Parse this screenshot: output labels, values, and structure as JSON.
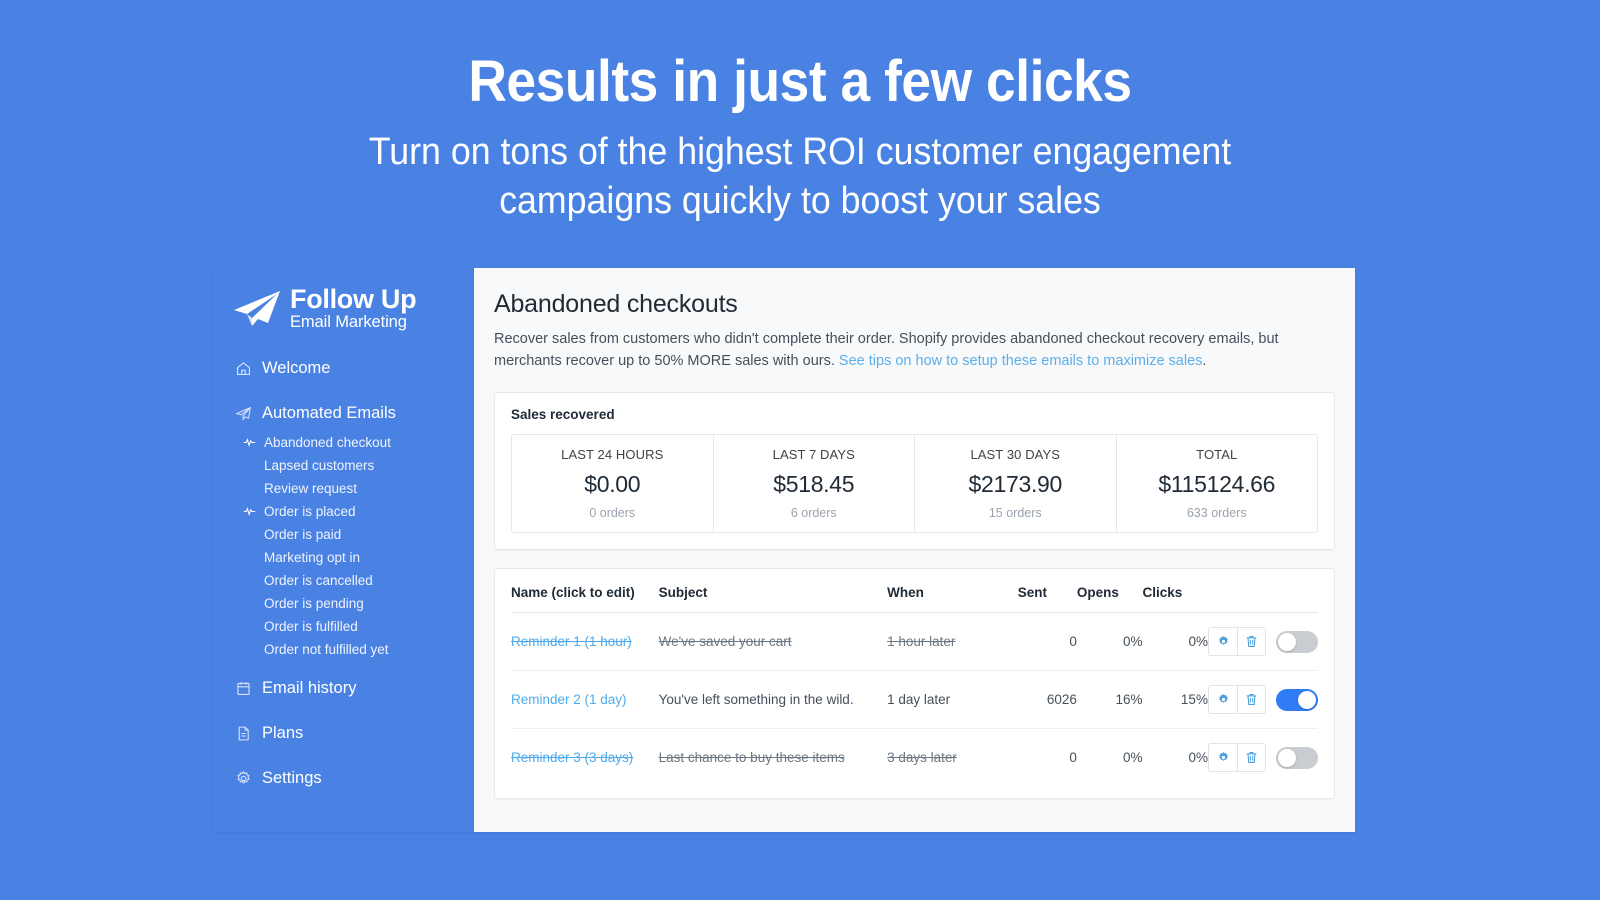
{
  "hero": {
    "title": "Results in just a few clicks",
    "subtitle_line1": "Turn on tons of the highest ROI customer engagement",
    "subtitle_line2": "campaigns quickly to boost your sales",
    "background_color": "#4a82e4"
  },
  "sidebar": {
    "background_color": "#4a82e4",
    "logo": {
      "icon": "paper-plane-icon",
      "title": "Follow Up",
      "subtitle": "Email Marketing"
    },
    "items": [
      {
        "label": "Welcome",
        "icon": "home-icon"
      },
      {
        "label": "Automated Emails",
        "icon": "paper-plane-icon"
      },
      {
        "label": "Email history",
        "icon": "calendar-icon"
      },
      {
        "label": "Plans",
        "icon": "document-icon"
      },
      {
        "label": "Settings",
        "icon": "gear-icon"
      }
    ],
    "sub_items": [
      {
        "label": "Abandoned checkout",
        "icon": "pulse-icon",
        "active": true
      },
      {
        "label": "Lapsed customers",
        "icon": "",
        "active": false
      },
      {
        "label": "Review request",
        "icon": "",
        "active": false
      },
      {
        "label": "Order is placed",
        "icon": "pulse-icon",
        "active": true
      },
      {
        "label": "Order is paid",
        "icon": "",
        "active": false
      },
      {
        "label": "Marketing opt in",
        "icon": "",
        "active": false
      },
      {
        "label": "Order is cancelled",
        "icon": "",
        "active": false
      },
      {
        "label": "Order is pending",
        "icon": "",
        "active": false
      },
      {
        "label": "Order is fulfilled",
        "icon": "",
        "active": false
      },
      {
        "label": "Order not fulfilled yet",
        "icon": "",
        "active": false
      }
    ]
  },
  "main": {
    "page_title": "Abandoned checkouts",
    "description_part1": "Recover sales from customers who didn't complete their order. Shopify provides abandoned checkout recovery emails, but merchants recover up to 50% MORE sales with ours. ",
    "description_link": "See tips on how to setup these emails to maximize sales",
    "description_part2": ".",
    "link_color": "#5cafe9",
    "stats": {
      "title": "Sales recovered",
      "cells": [
        {
          "label": "LAST 24 HOURS",
          "value": "$0.00",
          "orders": "0 orders"
        },
        {
          "label": "LAST 7 DAYS",
          "value": "$518.45",
          "orders": "6 orders"
        },
        {
          "label": "LAST 30 DAYS",
          "value": "$2173.90",
          "orders": "15 orders"
        },
        {
          "label": "TOTAL",
          "value": "$115124.66",
          "orders": "633 orders"
        }
      ]
    },
    "table": {
      "headers": {
        "name": "Name (click to edit)",
        "subject": "Subject",
        "when": "When",
        "sent": "Sent",
        "opens": "Opens",
        "clicks": "Clicks"
      },
      "rows": [
        {
          "name": "Reminder 1 (1 hour)",
          "subject": "We've saved your cart",
          "when": "1 hour later",
          "sent": "0",
          "opens": "0%",
          "clicks": "0%",
          "enabled": false
        },
        {
          "name": "Reminder 2 (1 day)",
          "subject": "You've left something in the wild.",
          "when": "1 day later",
          "sent": "6026",
          "opens": "16%",
          "clicks": "15%",
          "enabled": true
        },
        {
          "name": "Reminder 3 (3 days)",
          "subject": "Last chance to buy these items",
          "when": "3 days later",
          "sent": "0",
          "opens": "0%",
          "clicks": "0%",
          "enabled": false
        }
      ],
      "row_action_icons": [
        "gear-icon",
        "trash-icon",
        "toggle-switch"
      ],
      "toggle_on_color": "#2f7cf6",
      "toggle_off_color": "#c9cdd2"
    }
  }
}
